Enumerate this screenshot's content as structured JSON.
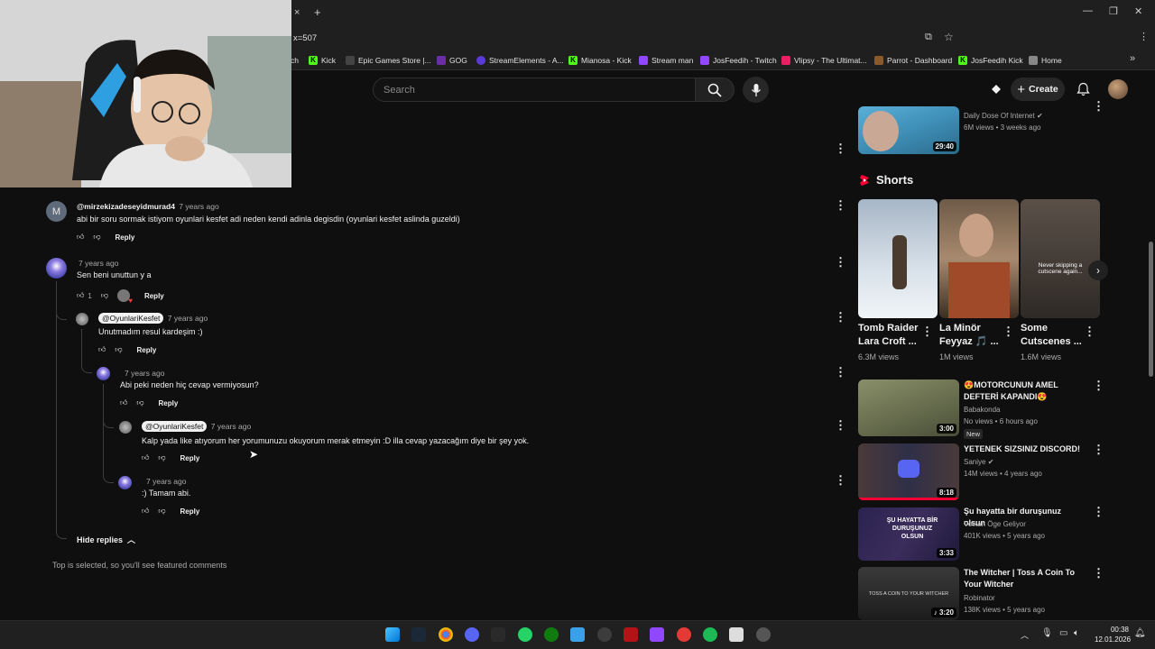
{
  "browser": {
    "url_fragment": "x=507",
    "new_tab_symbol": "+",
    "close_tab_symbol": "×",
    "bookmarks": [
      {
        "label": "ch",
        "color": "#1f1f1f"
      },
      {
        "label": "Kick",
        "color": "#53fc18"
      },
      {
        "label": "Epic Games Store |...",
        "color": "#333333"
      },
      {
        "label": "GOG",
        "color": "#6a2ea8"
      },
      {
        "label": "StreamElements - A...",
        "color": "#5b3bd6"
      },
      {
        "label": "Mianosa - Kick",
        "color": "#53fc18"
      },
      {
        "label": "Stream man",
        "color": "#9146ff"
      },
      {
        "label": "JosFeedih - Twitch",
        "color": "#9146ff"
      },
      {
        "label": "Vlipsy - The Ultimat...",
        "color": "#e91e63"
      },
      {
        "label": "Parrot - Dashboard",
        "color": "#8b5a2b"
      },
      {
        "label": "JosFeedih Kick",
        "color": "#53fc18"
      },
      {
        "label": "Home",
        "color": "#888888"
      }
    ],
    "more_bookmarks": "»"
  },
  "header": {
    "search_placeholder": "Search",
    "create_label": "Create"
  },
  "comments": [
    {
      "author": "@mirzekizadeseyidmurad4",
      "date": "7 years ago",
      "text": "abi bir soru sormak istiyom oyunlari kesfet adi neden kendi adinla degisdin (oyunlari kesfet aslinda guzeldi)",
      "likes": "",
      "reply_label": "Reply",
      "avatar_letter": "M"
    },
    {
      "author": "",
      "date": "7 years ago",
      "text": "Sen beni unuttun y a",
      "likes": "1",
      "reply_label": "Reply"
    },
    {
      "author": "@OyunlariKesfet",
      "date": "7 years ago",
      "text": "Unutmadım resul kardeşim :)",
      "likes": "",
      "reply_label": "Reply"
    },
    {
      "author": "",
      "date": "7 years ago",
      "text": "Abi peki neden hiç cevap vermiyosun?",
      "likes": "",
      "reply_label": "Reply"
    },
    {
      "author": "@OyunlariKesfet",
      "date": "7 years ago",
      "text": "Kalp yada like atıyorum her yorumunuzu okuyorum merak etmeyin :D illa cevap yazacağım diye bir şey yok.",
      "likes": "",
      "reply_label": "Reply"
    },
    {
      "author": "",
      "date": "7 years ago",
      "text": ":) Tamam abi.",
      "likes": "",
      "reply_label": "Reply"
    }
  ],
  "hide_replies_label": "Hide replies",
  "featured_note": "Top is selected, so you'll see featured comments",
  "sidebar": {
    "top_video": {
      "channel": "Daily Dose Of Internet",
      "meta": "6M views • 3 weeks ago",
      "duration": "29:40"
    },
    "shorts_heading": "Shorts",
    "shorts": [
      {
        "title": "Tomb Raider Lara Croft ...",
        "views": "6.3M views",
        "overlay": ""
      },
      {
        "title": "La Minör Feyyaz 🎵 ...",
        "views": "1M views",
        "overlay": ""
      },
      {
        "title": "Some Cutscenes ...",
        "views": "1.6M views",
        "overlay": "Never skipping a cutscene again..."
      }
    ],
    "videos": [
      {
        "title": "😍MOTORCUNUN AMEL DEFTERİ KAPANDI😍",
        "channel": "Babakonda",
        "meta": "No views • 6 hours ago",
        "duration": "3:00",
        "badge": "New",
        "thumb": "#6a7050"
      },
      {
        "title": "YETENEK SIZSINIZ DISCORD!",
        "channel": "Saniye",
        "meta": "14M views • 4 years ago",
        "duration": "8:18",
        "badge": "",
        "thumb": "#3a3548"
      },
      {
        "title": "Şu hayatta bir duruşunuz olsun",
        "channel": "Volkan Öge Geliyor",
        "meta": "401K views • 5 years ago",
        "duration": "3:33",
        "badge": "",
        "thumb": "#3b2d5c",
        "overlay": "ŞU HAYATTA BİR DURUŞUNUZ OLSUN"
      },
      {
        "title": "The Witcher | Toss A Coin To Your Witcher",
        "channel": "Robinator",
        "meta": "138K views • 5 years ago",
        "duration": "3:20",
        "badge": "",
        "thumb": "#2a2a2a",
        "overlay": "TOSS A COIN TO YOUR WITCHER"
      }
    ]
  },
  "taskbar": {
    "time": "00:38",
    "date": "12.01.2026"
  }
}
